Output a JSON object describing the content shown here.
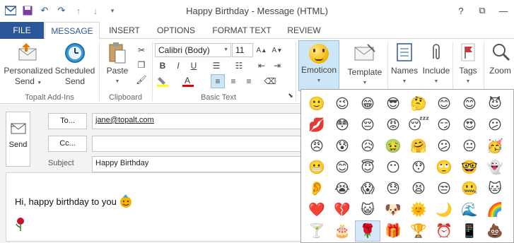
{
  "window": {
    "title": "Happy Birthday - Message (HTML)",
    "controls": [
      "?",
      "⧉",
      "—"
    ]
  },
  "qat": [
    "outlook-icon",
    "save-icon",
    "undo-icon",
    "redo-icon",
    "up-icon",
    "down-icon",
    "customize-icon"
  ],
  "tabs": [
    "FILE",
    "MESSAGE",
    "INSERT",
    "OPTIONS",
    "FORMAT TEXT",
    "REVIEW"
  ],
  "ribbon": {
    "personalized": [
      "Personalized",
      "Send"
    ],
    "scheduled": [
      "Scheduled",
      "Send"
    ],
    "topalt_label": "Topalt Add-Ins",
    "paste": "Paste",
    "clipboard_label": "Clipboard",
    "font_name": "Calibri (Body)",
    "font_size": "11",
    "basictext_label": "Basic Text",
    "emoticon": "Emoticon",
    "template": "Template",
    "names": "Names",
    "include": "Include",
    "tags": "Tags",
    "zoom": "Zoom"
  },
  "compose": {
    "send": "Send",
    "to_button": "To...",
    "cc_button": "Cc...",
    "subject_label": "Subject",
    "to_value": "jane@topalt.com",
    "cc_value": "",
    "subject_value": "Happy Birthday",
    "body_text": "Hi, happy birthday to you"
  },
  "emoticons": [
    "🙂",
    "😉",
    "😁",
    "😎",
    "🤔",
    "😊",
    "😊",
    "😈",
    "💋",
    "😳",
    "😔",
    "😡",
    "😴",
    "😏",
    "😍",
    "😕",
    "😠",
    "😰",
    "😥",
    "🤢",
    "🤗",
    "😕",
    "😐",
    "🥳",
    "😬",
    "😊",
    "😇",
    "😶",
    "😯",
    "🙄",
    "🤓",
    "👻",
    "👂",
    "😭",
    "😱",
    "😓",
    "😫",
    "😒",
    "🤐",
    "🐱",
    "❤️",
    "💔",
    "😺",
    "🐶",
    "🌞",
    "🌙",
    "🌊",
    "🌈",
    "🍸",
    "🎂",
    "🌹",
    "🎁",
    "🏆",
    "⏰",
    "📱",
    "💩"
  ],
  "emoticon_selected_index": 50
}
